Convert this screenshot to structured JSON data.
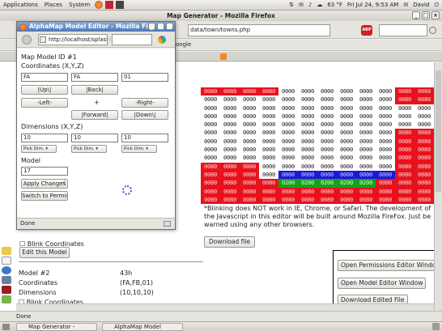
{
  "panel": {
    "menus": [
      "Applications",
      "Places",
      "System"
    ],
    "window_title": "Map Generator - Mozilla Firefox",
    "weather": "63 °F",
    "clock": "Fri Jul 24,  9:53 AM",
    "user": "David"
  },
  "firefox": {
    "url_fragment": "data/town/towns.php",
    "bookmark": "oogle",
    "status": "Done"
  },
  "grid": {
    "rows": [
      [
        "0080",
        "0080",
        "0080",
        "0080",
        "0000",
        "0000",
        "0000",
        "0000",
        "0000",
        "0000",
        "0080",
        "0080"
      ],
      [
        "0000",
        "0000",
        "0000",
        "0000",
        "0000",
        "0000",
        "0000",
        "0000",
        "0000",
        "0000",
        "0080",
        "0080"
      ],
      [
        "0000",
        "0000",
        "0000",
        "0000",
        "0000",
        "0000",
        "0000",
        "0000",
        "0000",
        "0000",
        "0000",
        "0000"
      ],
      [
        "0000",
        "0000",
        "0000",
        "0000",
        "0000",
        "0000",
        "0000",
        "0000",
        "0000",
        "0000",
        "0000",
        "0000"
      ],
      [
        "0000",
        "0000",
        "0000",
        "0000",
        "0000",
        "0000",
        "0000",
        "0000",
        "0000",
        "0000",
        "0000",
        "0000"
      ],
      [
        "0000",
        "0000",
        "0000",
        "0000",
        "0000",
        "0000",
        "0000",
        "0000",
        "0000",
        "0000",
        "0080",
        "0080"
      ],
      [
        "0000",
        "0000",
        "0000",
        "0000",
        "0000",
        "0000",
        "0000",
        "0000",
        "0000",
        "0000",
        "0080",
        "0080"
      ],
      [
        "0000",
        "0000",
        "0000",
        "0000",
        "0000",
        "0000",
        "0000",
        "0000",
        "0000",
        "0000",
        "0080",
        "0080"
      ],
      [
        "0000",
        "0000",
        "0000",
        "0000",
        "0000",
        "0000",
        "0000",
        "0000",
        "0000",
        "0000",
        "0080",
        "0080"
      ],
      [
        "0080",
        "0080",
        "0080",
        "0000",
        "0000",
        "0000",
        "0000",
        "0000",
        "0000",
        "0000",
        "0080",
        "0080"
      ],
      [
        "0080",
        "0080",
        "0080",
        "0000",
        "0000",
        "0000",
        "0000",
        "0000",
        "0000",
        "0000",
        "0080",
        "0080"
      ],
      [
        "0080",
        "0080",
        "0080",
        "0080",
        "0200",
        "0200",
        "0200",
        "0200",
        "0200",
        "0080",
        "0080",
        "0080"
      ],
      [
        "0080",
        "0080",
        "0080",
        "0080",
        "0080",
        "0080",
        "0080",
        "0080",
        "0080",
        "0080",
        "0080",
        "0080"
      ],
      [
        "0080",
        "0080",
        "0080",
        "0080",
        "0080",
        "0080",
        "0080",
        "0080",
        "0080",
        "0080",
        "0080",
        "0080"
      ]
    ],
    "colors": [
      [
        "r",
        "r",
        "r",
        "r",
        "w",
        "w",
        "w",
        "w",
        "w",
        "w",
        "r",
        "r"
      ],
      [
        "w",
        "w",
        "w",
        "w",
        "w",
        "w",
        "w",
        "w",
        "w",
        "w",
        "r",
        "r"
      ],
      [
        "w",
        "w",
        "w",
        "w",
        "w",
        "w",
        "w",
        "w",
        "w",
        "w",
        "w",
        "w"
      ],
      [
        "w",
        "w",
        "w",
        "w",
        "w",
        "w",
        "w",
        "w",
        "w",
        "w",
        "w",
        "w"
      ],
      [
        "w",
        "w",
        "w",
        "w",
        "w",
        "w",
        "w",
        "w",
        "w",
        "w",
        "w",
        "w"
      ],
      [
        "w",
        "w",
        "w",
        "w",
        "w",
        "w",
        "w",
        "w",
        "w",
        "w",
        "r",
        "r"
      ],
      [
        "w",
        "w",
        "w",
        "w",
        "w",
        "w",
        "w",
        "w",
        "w",
        "w",
        "r",
        "r"
      ],
      [
        "w",
        "w",
        "w",
        "w",
        "w",
        "w",
        "w",
        "w",
        "w",
        "w",
        "r",
        "r"
      ],
      [
        "w",
        "w",
        "w",
        "w",
        "w",
        "w",
        "w",
        "w",
        "w",
        "w",
        "r",
        "r"
      ],
      [
        "r",
        "r",
        "r",
        "w",
        "w",
        "w",
        "w",
        "w",
        "w",
        "w",
        "r",
        "r"
      ],
      [
        "r",
        "r",
        "r",
        "w",
        "b",
        "b",
        "b",
        "b",
        "b",
        "b",
        "r",
        "r"
      ],
      [
        "r",
        "r",
        "r",
        "r",
        "g",
        "g",
        "g",
        "g",
        "g",
        "r",
        "r",
        "r"
      ],
      [
        "r",
        "r",
        "r",
        "r",
        "r",
        "r",
        "r",
        "r",
        "r",
        "r",
        "r",
        "r"
      ],
      [
        "r",
        "r",
        "r",
        "r",
        "r",
        "r",
        "r",
        "r",
        "r",
        "r",
        "r",
        "r"
      ]
    ]
  },
  "blink_note": "*Blinking does NOT work in IE, Chrome, or Safari. The development of the Javascript in this editor will be built around Mozilla FireFox. Just be warned using any other browsers.",
  "download_file_label": "Download file",
  "page": {
    "blink_coords_cut": "Blink Coordinates",
    "edit_model_label": "Edit this Model",
    "model2_label": "Model #2",
    "model2_id": "43h",
    "coords_label": "Coordinates",
    "coords_value": "(FA,FB,01)",
    "dims_label": "Dimensions",
    "dims_value": "(10,10,10)",
    "blink2_label": "Blink Coordinates"
  },
  "commands": {
    "permissions": "Open Permissions Editor Window",
    "model_editor": "Open Model Editor Window",
    "download_edited": "Download Edited File"
  },
  "taskbar": {
    "task1": "Map Generator - Mozil...",
    "task2": "AlphaMap Model Edito..."
  },
  "popup": {
    "title": "AlphaMap Model Editor - Mozilla Fi",
    "url": "http://localhost/splash",
    "model_id": "Map Model ID #1",
    "coords_heading": "Coordinates (X,Y,Z)",
    "x": "FA",
    "y": "FA",
    "z": "01",
    "up": "|Up\\|",
    "back": "|Back|",
    "left": "-Left-",
    "center": "+",
    "right": "-Right-",
    "forward": "|Forward|",
    "down": "|Down\\|",
    "dims_heading": "Dimensions (X,Y,Z)",
    "dx": "10",
    "dy": "10",
    "dz": "10",
    "pick": "Pick Dim.",
    "model_heading": "Model",
    "model_value": "17",
    "apply": "Apply Changes",
    "switch": "Switch to Permissions",
    "status": "Done"
  }
}
